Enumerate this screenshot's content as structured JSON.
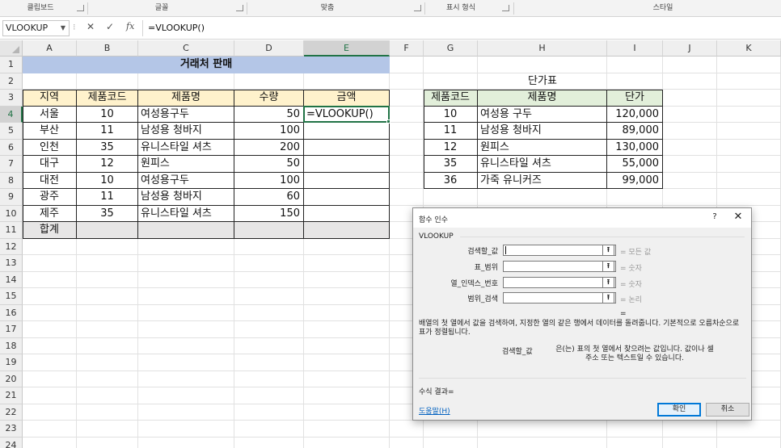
{
  "ribbon": {
    "groups": [
      "클립보드",
      "글꼴",
      "맞춤",
      "표시 형식",
      "스타일"
    ]
  },
  "formula_bar": {
    "name_box": "VLOOKUP",
    "formula": "=VLOOKUP()",
    "cancel_icon": "✕",
    "enter_icon": "✓",
    "fx_icon": "fx"
  },
  "columns": [
    "A",
    "B",
    "C",
    "D",
    "E",
    "F",
    "G",
    "H",
    "I",
    "J",
    "K"
  ],
  "rows": [
    "1",
    "2",
    "3",
    "4",
    "5",
    "6",
    "7",
    "8",
    "9",
    "10",
    "11",
    "12",
    "13",
    "14",
    "15",
    "16",
    "17",
    "18",
    "19",
    "20",
    "21",
    "22",
    "23",
    "24"
  ],
  "sales": {
    "title": "거래처 판매",
    "headers": [
      "지역",
      "제품코드",
      "제품명",
      "수량",
      "금액"
    ],
    "rows": [
      [
        "서울",
        "10",
        "여성용구두",
        "50",
        "=VLOOKUP()"
      ],
      [
        "부산",
        "11",
        "남성용 청바지",
        "100",
        ""
      ],
      [
        "인천",
        "35",
        "유니스타일 셔츠",
        "200",
        ""
      ],
      [
        "대구",
        "12",
        "원피스",
        "50",
        ""
      ],
      [
        "대전",
        "10",
        "여성용구두",
        "100",
        ""
      ],
      [
        "광주",
        "11",
        "남성용 청바지",
        "60",
        ""
      ],
      [
        "제주",
        "35",
        "유니스타일 셔츠",
        "150",
        ""
      ]
    ],
    "total_label": "합계"
  },
  "price_table": {
    "title": "단가표",
    "headers": [
      "제품코드",
      "제품명",
      "단가"
    ],
    "rows": [
      [
        "10",
        "여성용 구두",
        "120,000"
      ],
      [
        "11",
        "남성용 청바지",
        "89,000"
      ],
      [
        "12",
        "원피스",
        "130,000"
      ],
      [
        "35",
        "유니스타일 셔츠",
        "55,000"
      ],
      [
        "36",
        "가죽 유니커즈",
        "99,000"
      ]
    ]
  },
  "dialog": {
    "title": "함수 인수",
    "help_icon": "?",
    "close_icon": "✕",
    "function_name": "VLOOKUP",
    "args": [
      {
        "label": "검색할_값",
        "result": "=  모든 값"
      },
      {
        "label": "표_범위",
        "result": "=  숫자"
      },
      {
        "label": "열_인덱스_번호",
        "result": "=  숫자"
      },
      {
        "label": "범위_검색",
        "result": "=  논리"
      }
    ],
    "equals": "=",
    "description": "배열의 첫 열에서 값을 검색하여, 지정한 열의 같은 행에서 데이터를 돌려줍니다. 기본적으로 오름차순으로 표가 정렬됩니다.",
    "arg_desc_name": "검색할_값",
    "arg_desc": "은(는) 표의 첫 열에서 찾으려는 값입니다. 값이나 셀 주소 또는 텍스트일 수 있습니다.",
    "result_label": "수식 결과=",
    "help_link": "도움말(H)",
    "ok_label": "확인",
    "cancel_label": "취소",
    "ref_icon": "⭱"
  },
  "colors": {
    "title_band": "#b4c6e7",
    "header_yellow": "#fff2cc",
    "header_green": "#e2efda",
    "total_gray": "#e7e6e6",
    "active_border": "#217346"
  }
}
